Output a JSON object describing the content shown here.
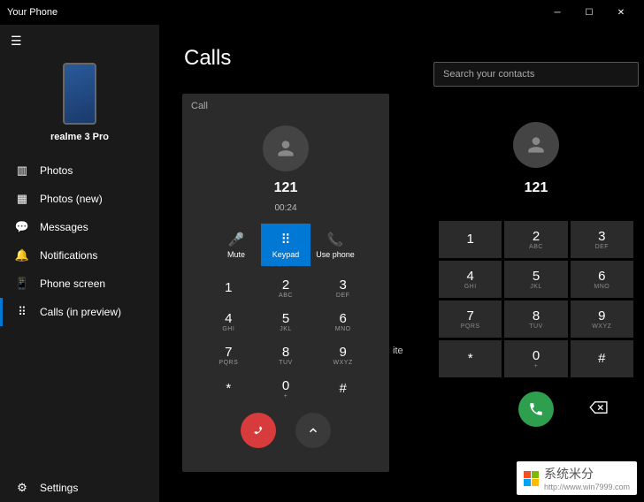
{
  "titlebar": {
    "title": "Your Phone"
  },
  "sidebar": {
    "phone_name": "realme 3 Pro",
    "items": [
      {
        "icon": "photos-icon",
        "label": "Photos"
      },
      {
        "icon": "photos-new-icon",
        "label": "Photos (new)"
      },
      {
        "icon": "messages-icon",
        "label": "Messages"
      },
      {
        "icon": "notifications-icon",
        "label": "Notifications"
      },
      {
        "icon": "phone-screen-icon",
        "label": "Phone screen"
      },
      {
        "icon": "calls-icon",
        "label": "Calls (in preview)"
      }
    ],
    "settings_label": "Settings"
  },
  "page": {
    "title": "Calls"
  },
  "call_panel": {
    "header": "Call",
    "number": "121",
    "timer": "00:24",
    "actions": {
      "mute": "Mute",
      "keypad": "Keypad",
      "usephone": "Use phone"
    },
    "orphan": "ite"
  },
  "dialer": {
    "search_placeholder": "Search your contacts",
    "number": "121"
  },
  "keys": [
    {
      "n": "1",
      "s": ""
    },
    {
      "n": "2",
      "s": "ABC"
    },
    {
      "n": "3",
      "s": "DEF"
    },
    {
      "n": "4",
      "s": "GHI"
    },
    {
      "n": "5",
      "s": "JKL"
    },
    {
      "n": "6",
      "s": "MNO"
    },
    {
      "n": "7",
      "s": "PQRS"
    },
    {
      "n": "8",
      "s": "TUV"
    },
    {
      "n": "9",
      "s": "WXYZ"
    },
    {
      "n": "*",
      "s": ""
    },
    {
      "n": "0",
      "s": "+"
    },
    {
      "n": "#",
      "s": ""
    }
  ],
  "watermark": {
    "text": "系统米分",
    "url": "http://www.win7999.com"
  }
}
